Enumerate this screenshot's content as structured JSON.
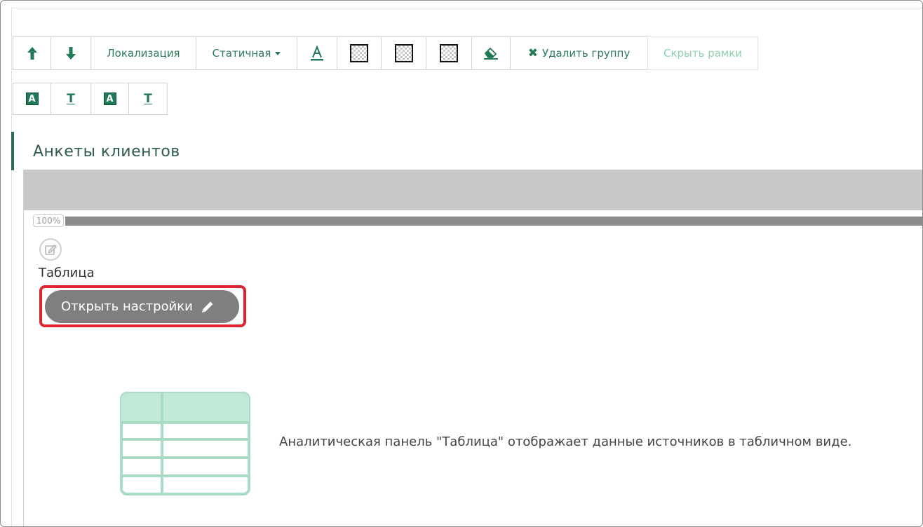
{
  "toolbar": {
    "up_label": "↑",
    "down_label": "↓",
    "localization": "Локализация",
    "static": "Статичная",
    "delete_group": "Удалить группу",
    "hide_frames": "Скрыть рамки"
  },
  "section": {
    "title": "Анкеты клиентов"
  },
  "panel": {
    "progress_label": "100%",
    "progress_fraction": 1.0,
    "type_label": "Таблица",
    "settings_button": "Открыть настройки",
    "description": "Аналитическая панель \"Таблица\" отображает данные источников в табличном виде."
  },
  "colors": {
    "accent": "#2d7a5a",
    "highlight": "#e0242f",
    "button_gray": "#7f7f7f"
  }
}
